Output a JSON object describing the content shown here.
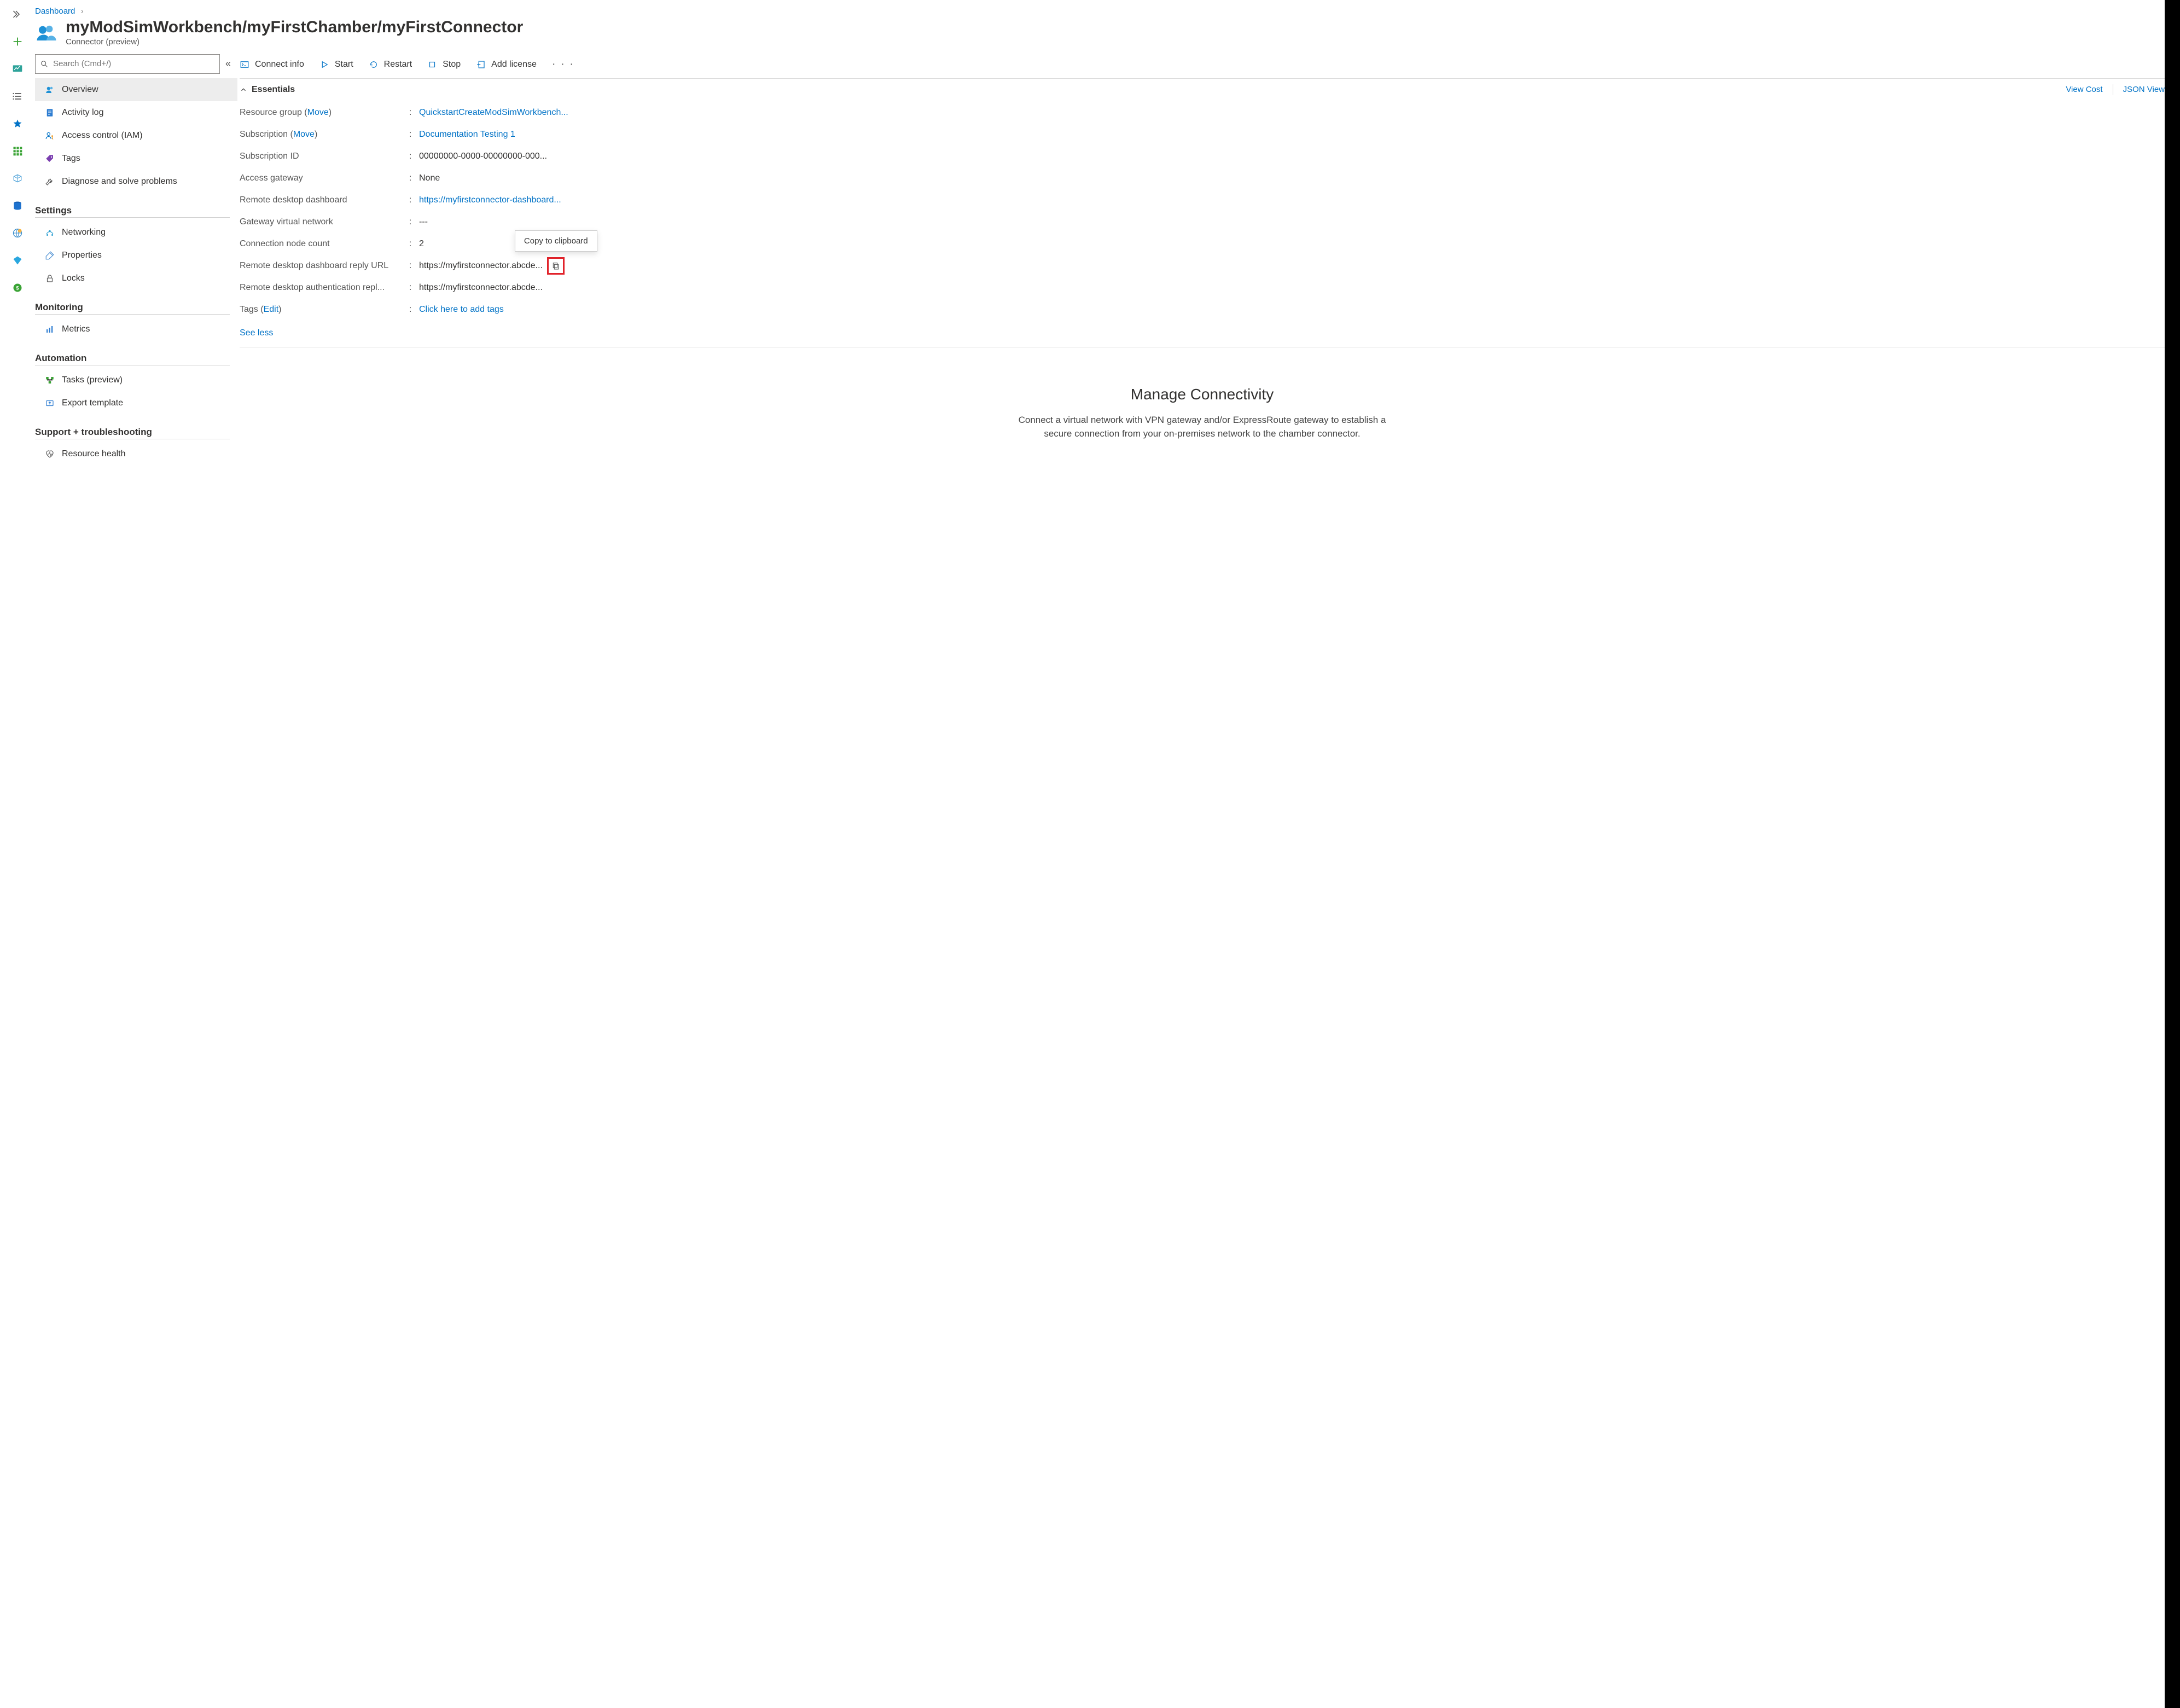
{
  "breadcrumb": {
    "root": "Dashboard"
  },
  "header": {
    "title": "myModSimWorkbench/myFirstChamber/myFirstConnector",
    "subtitle": "Connector (preview)"
  },
  "search": {
    "placeholder": "Search (Cmd+/)"
  },
  "nav": {
    "top": [
      {
        "label": "Overview",
        "icon": "people"
      },
      {
        "label": "Activity log",
        "icon": "log"
      },
      {
        "label": "Access control (IAM)",
        "icon": "iam"
      },
      {
        "label": "Tags",
        "icon": "tag"
      },
      {
        "label": "Diagnose and solve problems",
        "icon": "wrench"
      }
    ],
    "groups": [
      {
        "title": "Settings",
        "items": [
          {
            "label": "Networking",
            "icon": "net"
          },
          {
            "label": "Properties",
            "icon": "props"
          },
          {
            "label": "Locks",
            "icon": "lock"
          }
        ]
      },
      {
        "title": "Monitoring",
        "items": [
          {
            "label": "Metrics",
            "icon": "metrics"
          }
        ]
      },
      {
        "title": "Automation",
        "items": [
          {
            "label": "Tasks (preview)",
            "icon": "tasks"
          },
          {
            "label": "Export template",
            "icon": "export"
          }
        ]
      },
      {
        "title": "Support + troubleshooting",
        "items": [
          {
            "label": "Resource health",
            "icon": "health"
          }
        ]
      }
    ]
  },
  "toolbar": {
    "connect_info": "Connect info",
    "start": "Start",
    "restart": "Restart",
    "stop": "Stop",
    "add_license": "Add license"
  },
  "essentials": {
    "label": "Essentials",
    "view_cost": "View Cost",
    "json_view": "JSON View",
    "rows": [
      {
        "key": "Resource group",
        "key_link": "Move",
        "value": "QuickstartCreateModSimWorkbench...",
        "link": true
      },
      {
        "key": "Subscription",
        "key_link": "Move",
        "value": "Documentation Testing 1",
        "link": true
      },
      {
        "key": "Subscription ID",
        "value": "00000000-0000-00000000-000..."
      },
      {
        "key": "Access gateway",
        "value": "None"
      },
      {
        "key": "Remote desktop dashboard",
        "value": "https://myfirstconnector-dashboard...",
        "link": true
      },
      {
        "key": "Gateway virtual network",
        "value": "---"
      },
      {
        "key": "Connection node count",
        "value": "2"
      },
      {
        "key": "Remote desktop dashboard reply URL",
        "value": "https://myfirstconnector.abcde...",
        "copy_highlight": true
      },
      {
        "key": "Remote desktop authentication repl...",
        "value": "https://myfirstconnector.abcde..."
      },
      {
        "key": "Tags",
        "key_link": "Edit",
        "value": "Click here to add tags",
        "link": true
      }
    ],
    "see_less": "See less"
  },
  "tooltip": {
    "copy": "Copy to clipboard"
  },
  "connectivity": {
    "title": "Manage Connectivity",
    "body": "Connect a virtual network with VPN gateway and/or ExpressRoute gateway to establish a secure connection from your on-premises network to the chamber connector."
  }
}
